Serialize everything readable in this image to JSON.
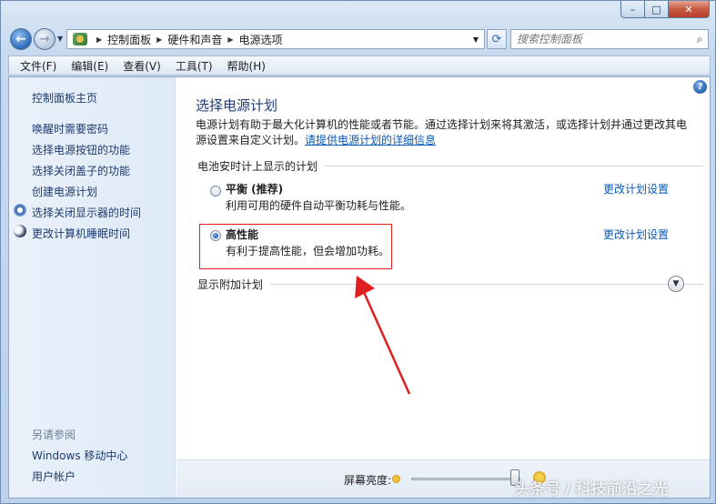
{
  "window": {
    "controls": {
      "minimize": "–",
      "maximize": "□",
      "close": "✕"
    }
  },
  "nav": {
    "back_icon": "arrow-left-icon",
    "forward_icon": "arrow-right-icon",
    "breadcrumbs": [
      "控制面板",
      "硬件和声音",
      "电源选项"
    ],
    "search_placeholder": "搜索控制面板"
  },
  "menu": {
    "items": [
      "文件(F)",
      "编辑(E)",
      "查看(V)",
      "工具(T)",
      "帮助(H)"
    ]
  },
  "sidebar": {
    "home": "控制面板主页",
    "links": [
      "唤醒时需要密码",
      "选择电源按钮的功能",
      "选择关闭盖子的功能",
      "创建电源计划",
      "选择关闭显示器的时间",
      "更改计算机睡眠时间"
    ],
    "see_also_title": "另请参阅",
    "see_also": [
      "Windows 移动中心",
      "用户帐户"
    ]
  },
  "main": {
    "title": "选择电源计划",
    "description": "电源计划有助于最大化计算机的性能或者节能。通过选择计划来将其激活，或选择计划并通过更改其电源设置来自定义计划。",
    "description_link": "请提供电源计划的详细信息",
    "section_title": "电池安时计上显示的计划",
    "plans": [
      {
        "name": "平衡 (推荐)",
        "desc": "利用可用的硬件自动平衡功耗与性能。",
        "link": "更改计划设置",
        "selected": false
      },
      {
        "name": "高性能",
        "desc": "有利于提高性能，但会增加功耗。",
        "link": "更改计划设置",
        "selected": true
      }
    ],
    "more_plans": "显示附加计划",
    "brightness_label": "屏幕亮度:",
    "brightness_level": 0.95,
    "annotation_color": "#e02020"
  },
  "watermark": "头条号 / 科技前沿之光"
}
